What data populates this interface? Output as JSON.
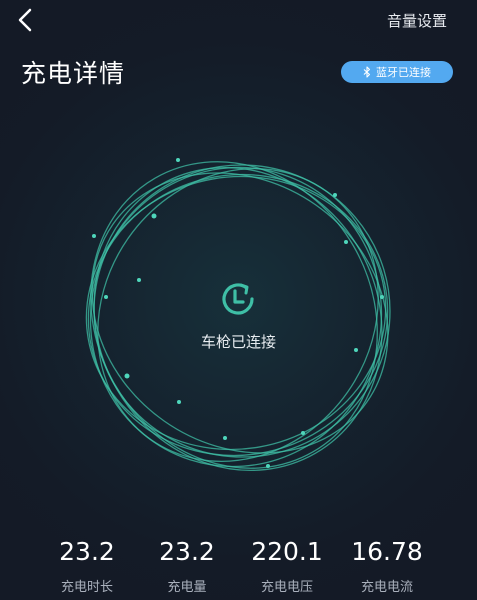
{
  "header": {
    "back_icon": "chevron-left-icon",
    "volume_settings_label": "音量设置"
  },
  "page": {
    "title": "充电详情"
  },
  "bluetooth": {
    "icon": "bluetooth-icon",
    "status_label": "蓝牙已连接"
  },
  "charger": {
    "icon": "clock-refresh-icon",
    "status_text": "车枪已连接"
  },
  "stats": [
    {
      "value": "23.2",
      "label": "充电时长"
    },
    {
      "value": "23.2",
      "label": "充电量"
    },
    {
      "value": "220.1",
      "label": "充电电压"
    },
    {
      "value": "16.78",
      "label": "充电电流"
    }
  ],
  "colors": {
    "background": "#141a26",
    "accent": "#3fbfa6",
    "badge": "#53a9f0"
  }
}
